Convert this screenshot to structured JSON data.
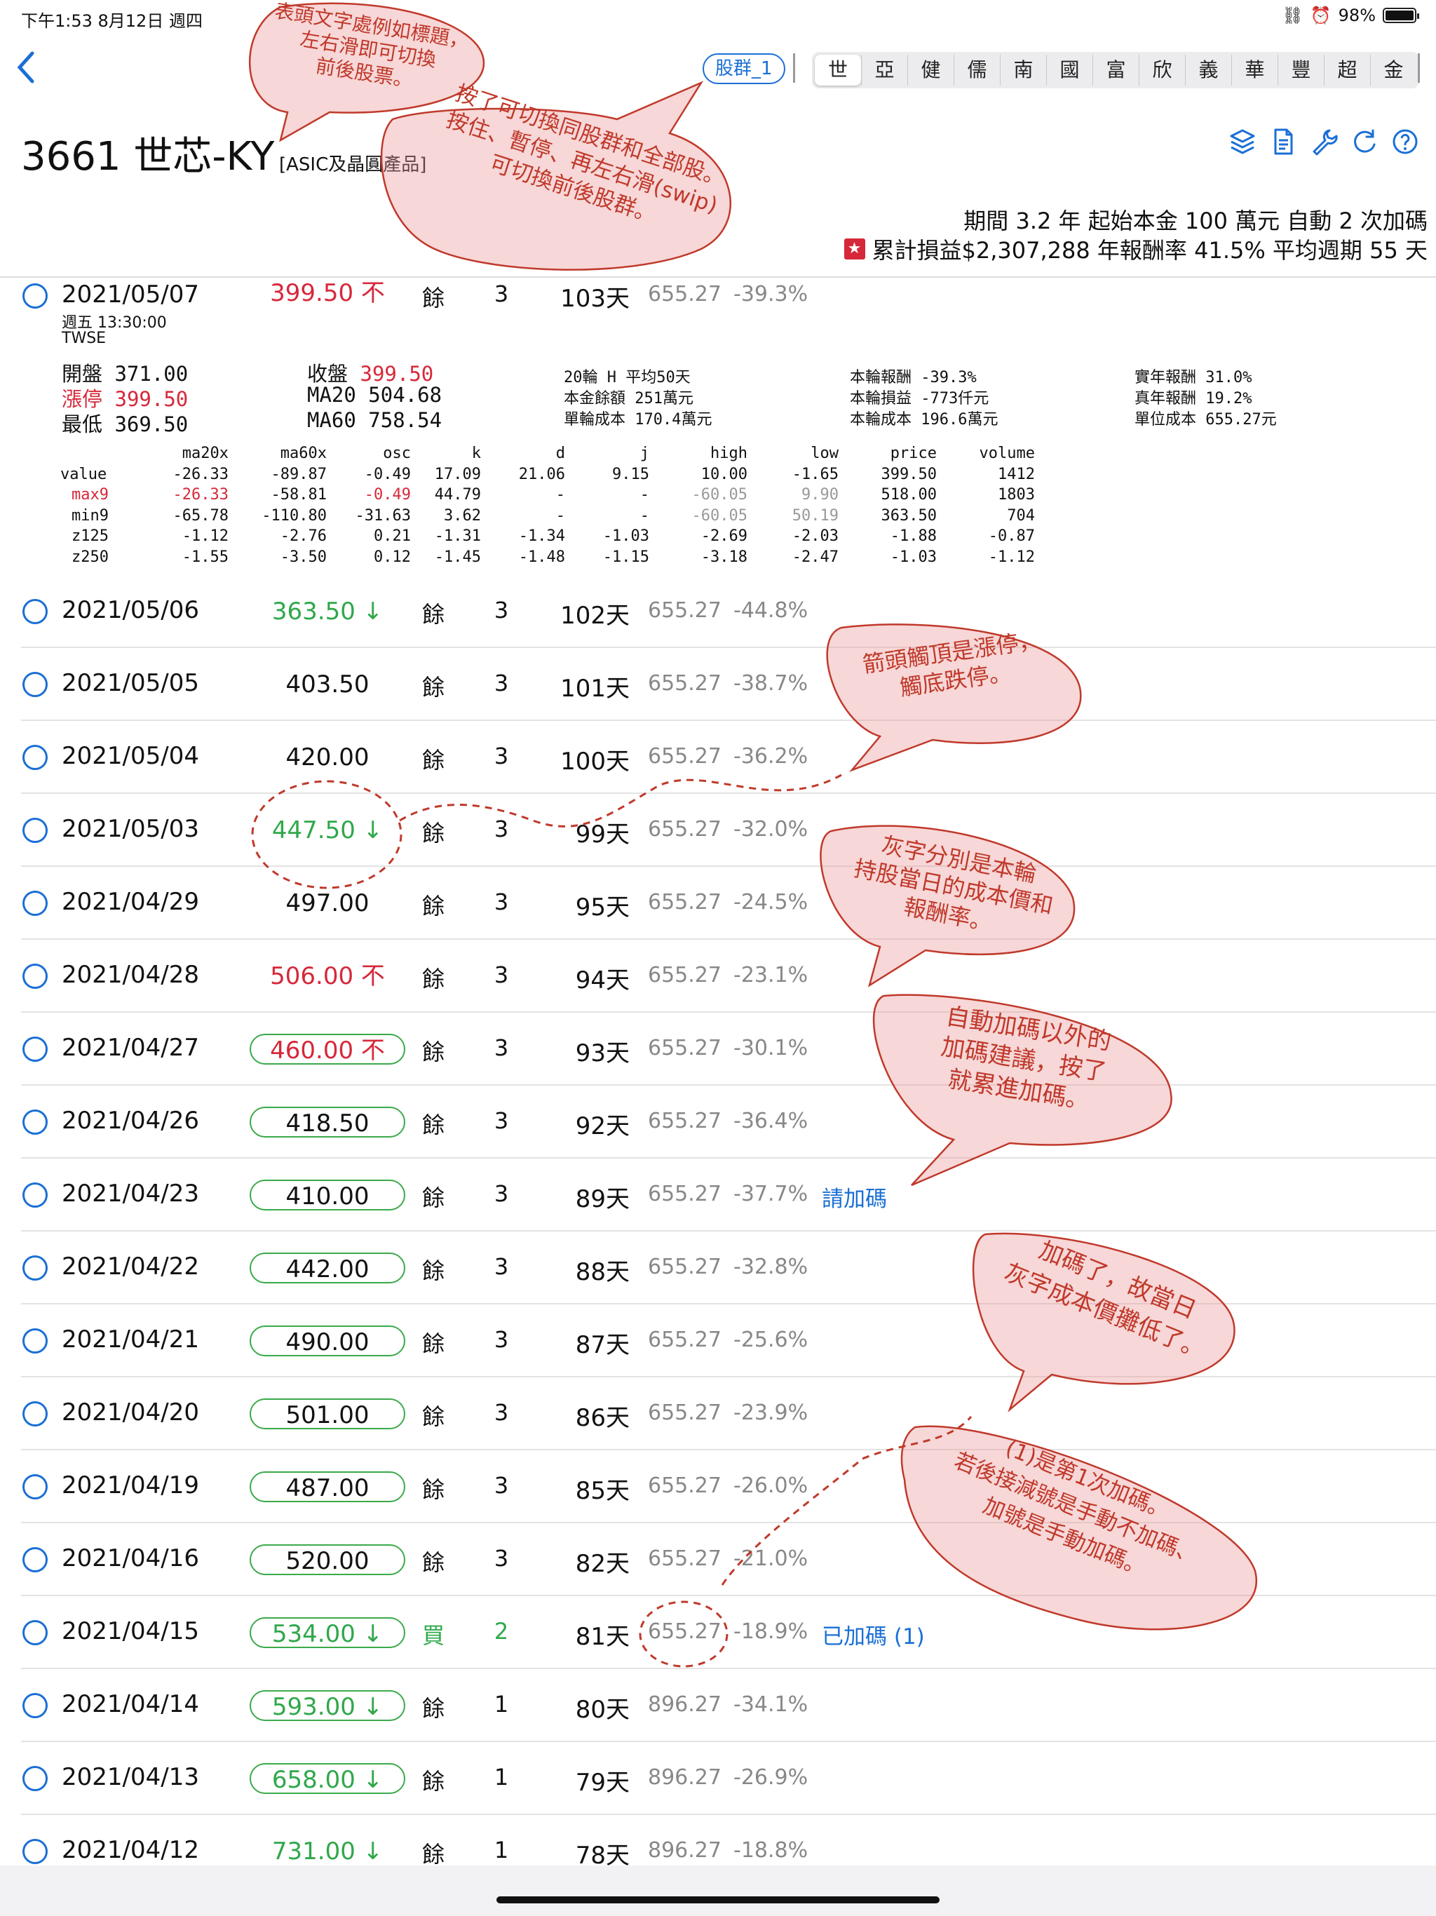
{
  "status": {
    "time": "下午1:53   8月12日 週四",
    "battery": "98%"
  },
  "nav": {
    "group_label": "股群_1",
    "segments": [
      "世",
      "亞",
      "健",
      "儒",
      "南",
      "國",
      "富",
      "欣",
      "義",
      "華",
      "豐",
      "超",
      "金"
    ]
  },
  "header": {
    "title": "3661 世芯-KY",
    "subtitle": "[ASIC及晶圓產品]",
    "summary_line1": "期間 3.2 年  起始本金 100 萬元  自動 2 次加碼",
    "summary_line2": "累計損益$2,307,288 年報酬率 41.5% 平均週期 55 天"
  },
  "detail": {
    "date": "2021/05/07",
    "weekday_time": "週五 13:30:00",
    "exchange": "TWSE",
    "open": "開盤 371.00",
    "limit_label": "漲停",
    "limit_value": "399.50",
    "low": "最低 369.50",
    "close_label": "收盤",
    "close_value": "399.50",
    "ma20": "MA20 504.68",
    "ma60": "MA60 758.54",
    "mid": [
      "20輪 H    平均50天",
      "本金餘額    251萬元",
      "單輪成本 170.4萬元"
    ],
    "right1": [
      "本輪報酬    -39.3%",
      "本輪損益   -773仟元",
      "本輪成本  196.6萬元"
    ],
    "right2": [
      "實年報酬     31.0%",
      "真年報酬     19.2%",
      "單位成本 655.27元"
    ],
    "stats_header": [
      "",
      "ma20x",
      "ma60x",
      "osc",
      "k",
      "d",
      "j",
      "high",
      "low",
      "price",
      "volume"
    ],
    "stats_rows": [
      [
        "value",
        "-26.33",
        "-89.87",
        "-0.49",
        "17.09",
        "21.06",
        "9.15",
        "10.00",
        "-1.65",
        "399.50",
        "1412"
      ],
      [
        "max9",
        "-26.33",
        "-58.81",
        "-0.49",
        "44.79",
        "-",
        "-",
        "-60.05",
        "9.90",
        "518.00",
        "1803"
      ],
      [
        "min9",
        "-65.78",
        "-110.80",
        "-31.63",
        "3.62",
        "-",
        "-",
        "-60.05",
        "50.19",
        "363.50",
        "704"
      ],
      [
        "z125",
        "-1.12",
        "-2.76",
        "0.21",
        "-1.31",
        "-1.34",
        "-1.03",
        "-2.69",
        "-2.03",
        "-1.88",
        "-0.87"
      ],
      [
        "z250",
        "-1.55",
        "-3.50",
        "0.12",
        "-1.45",
        "-1.48",
        "-1.15",
        "-3.18",
        "-2.47",
        "-1.03",
        "-1.12"
      ]
    ]
  },
  "first_row": {
    "price": "399.50 不",
    "action": "餘",
    "count": "3",
    "days": "103天",
    "cost": "655.27",
    "pct": "-39.3%"
  },
  "rows": [
    {
      "date": "2021/05/06",
      "price": "363.50 ↓",
      "action": "餘",
      "count": "3",
      "days": "102天",
      "cost": "655.27",
      "pct": "-44.8%",
      "note": ""
    },
    {
      "date": "2021/05/05",
      "price": "403.50",
      "action": "餘",
      "count": "3",
      "days": "101天",
      "cost": "655.27",
      "pct": "-38.7%",
      "note": ""
    },
    {
      "date": "2021/05/04",
      "price": "420.00",
      "action": "餘",
      "count": "3",
      "days": "100天",
      "cost": "655.27",
      "pct": "-36.2%",
      "note": ""
    },
    {
      "date": "2021/05/03",
      "price": "447.50 ↓",
      "action": "餘",
      "count": "3",
      "days": "99天",
      "cost": "655.27",
      "pct": "-32.0%",
      "note": ""
    },
    {
      "date": "2021/04/29",
      "price": "497.00",
      "action": "餘",
      "count": "3",
      "days": "95天",
      "cost": "655.27",
      "pct": "-24.5%",
      "note": ""
    },
    {
      "date": "2021/04/28",
      "price": "506.00 不",
      "action": "餘",
      "count": "3",
      "days": "94天",
      "cost": "655.27",
      "pct": "-23.1%",
      "note": ""
    },
    {
      "date": "2021/04/27",
      "price": "460.00 不",
      "action": "餘",
      "count": "3",
      "days": "93天",
      "cost": "655.27",
      "pct": "-30.1%",
      "note": ""
    },
    {
      "date": "2021/04/26",
      "price": "418.50",
      "action": "餘",
      "count": "3",
      "days": "92天",
      "cost": "655.27",
      "pct": "-36.4%",
      "note": ""
    },
    {
      "date": "2021/04/23",
      "price": "410.00",
      "action": "餘",
      "count": "3",
      "days": "89天",
      "cost": "655.27",
      "pct": "-37.7%",
      "note": "請加碼"
    },
    {
      "date": "2021/04/22",
      "price": "442.00",
      "action": "餘",
      "count": "3",
      "days": "88天",
      "cost": "655.27",
      "pct": "-32.8%",
      "note": ""
    },
    {
      "date": "2021/04/21",
      "price": "490.00",
      "action": "餘",
      "count": "3",
      "days": "87天",
      "cost": "655.27",
      "pct": "-25.6%",
      "note": ""
    },
    {
      "date": "2021/04/20",
      "price": "501.00",
      "action": "餘",
      "count": "3",
      "days": "86天",
      "cost": "655.27",
      "pct": "-23.9%",
      "note": ""
    },
    {
      "date": "2021/04/19",
      "price": "487.00",
      "action": "餘",
      "count": "3",
      "days": "85天",
      "cost": "655.27",
      "pct": "-26.0%",
      "note": ""
    },
    {
      "date": "2021/04/16",
      "price": "520.00",
      "action": "餘",
      "count": "3",
      "days": "82天",
      "cost": "655.27",
      "pct": "-21.0%",
      "note": ""
    },
    {
      "date": "2021/04/15",
      "price": "534.00 ↓",
      "action": "買",
      "count": "2",
      "days": "81天",
      "cost": "655.27",
      "pct": "-18.9%",
      "note": "已加碼 (1)"
    },
    {
      "date": "2021/04/14",
      "price": "593.00 ↓",
      "action": "餘",
      "count": "1",
      "days": "80天",
      "cost": "896.27",
      "pct": "-34.1%",
      "note": ""
    },
    {
      "date": "2021/04/13",
      "price": "658.00 ↓",
      "action": "餘",
      "count": "1",
      "days": "79天",
      "cost": "896.27",
      "pct": "-26.9%",
      "note": ""
    },
    {
      "date": "2021/04/12",
      "price": "731.00 ↓",
      "action": "餘",
      "count": "1",
      "days": "78天",
      "cost": "896.27",
      "pct": "-18.8%",
      "note": ""
    }
  ],
  "annotations": {
    "a1": "表頭文字處例如標題，\n左右滑即可切換\n前後股票。",
    "a2": "按了可切換同股群和全部股。\n按住、暫停、再左右滑(swip)\n可切換前後股群。",
    "a3": "箭頭觸頂是漲停，\n觸底跌停。",
    "a4": "灰字分別是本輪\n持股當日的成本價和\n報酬率。",
    "a5": "自動加碼以外的\n加碼建議，按了\n就累進加碼。",
    "a6": "加碼了，故當日\n灰字成本價攤低了。",
    "a7": "(1)是第1次加碼。\n若後接減號是手動不加碼、\n加號是手動加碼。"
  },
  "colors": {
    "accent": "#1a6fd6",
    "up": "#d6283a",
    "down": "#2fa84a",
    "annotation": "#c0392b"
  }
}
